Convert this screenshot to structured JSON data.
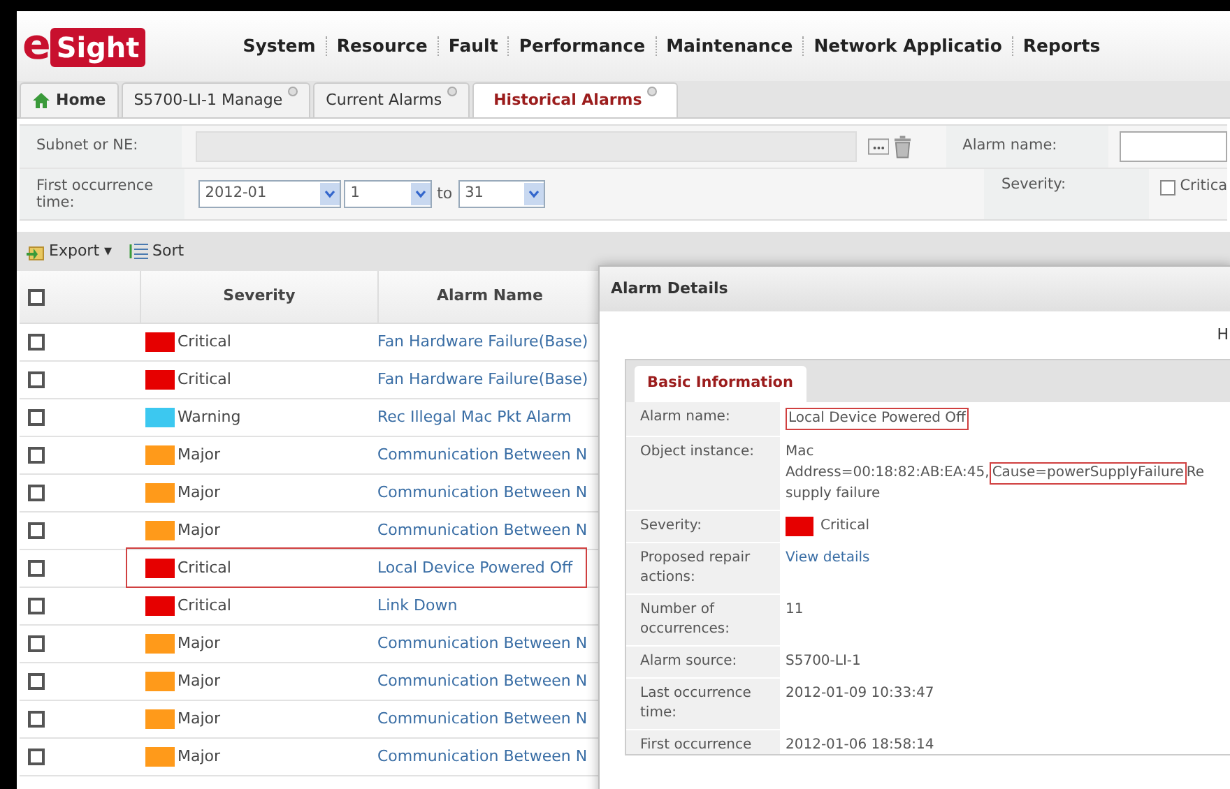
{
  "logo": {
    "text": "Sight",
    "prefix": "e"
  },
  "nav": [
    "System",
    "Resource",
    "Fault",
    "Performance",
    "Maintenance",
    "Network Applicatio",
    "Reports"
  ],
  "tabs": [
    {
      "label": "Home",
      "kind": "home",
      "selected": false
    },
    {
      "label": "S5700-LI-1 Manage",
      "kind": "page",
      "selected": false
    },
    {
      "label": "Current Alarms",
      "kind": "page",
      "selected": false
    },
    {
      "label": "Historical Alarms",
      "kind": "page",
      "selected": true
    }
  ],
  "filters": {
    "subnet_label": "Subnet or NE:",
    "time_label": "First occurrence time:",
    "month": "2012-01",
    "day_from": "1",
    "to_label": "to",
    "day_to": "31",
    "alarm_name_label": "Alarm name:",
    "severity_label": "Severity:",
    "severity_option": {
      "label": "Critica",
      "checked": false
    }
  },
  "toolbar": [
    "Export ▾",
    "Sort"
  ],
  "table": {
    "select_all": {
      "checked": false
    },
    "columns": [
      "Severity",
      "Alarm Name"
    ],
    "rows": [
      {
        "severity": "Critical",
        "color": "#e60000",
        "name": "Fan Hardware Failure(Base)",
        "checked": false,
        "highlighted": false
      },
      {
        "severity": "Critical",
        "color": "#e60000",
        "name": "Fan Hardware Failure(Base)",
        "checked": false,
        "highlighted": false
      },
      {
        "severity": "Warning",
        "color": "#3cc8f0",
        "name": "Rec Illegal Mac Pkt Alarm",
        "checked": false,
        "highlighted": false
      },
      {
        "severity": "Major",
        "color": "#ff9a1a",
        "name": "Communication Between N",
        "checked": false,
        "highlighted": false
      },
      {
        "severity": "Major",
        "color": "#ff9a1a",
        "name": "Communication Between N",
        "checked": false,
        "highlighted": false
      },
      {
        "severity": "Major",
        "color": "#ff9a1a",
        "name": "Communication Between N",
        "checked": false,
        "highlighted": false
      },
      {
        "severity": "Critical",
        "color": "#e60000",
        "name": "Local Device Powered Off",
        "checked": false,
        "highlighted": true
      },
      {
        "severity": "Critical",
        "color": "#e60000",
        "name": "Link Down",
        "checked": false,
        "highlighted": false
      },
      {
        "severity": "Major",
        "color": "#ff9a1a",
        "name": "Communication Between N",
        "checked": false,
        "highlighted": false
      },
      {
        "severity": "Major",
        "color": "#ff9a1a",
        "name": "Communication Between N",
        "checked": false,
        "highlighted": false
      },
      {
        "severity": "Major",
        "color": "#ff9a1a",
        "name": "Communication Between N",
        "checked": false,
        "highlighted": false
      },
      {
        "severity": "Major",
        "color": "#ff9a1a",
        "name": "Communication Between N",
        "checked": false,
        "highlighted": false
      }
    ]
  },
  "dialog": {
    "title": "Alarm Details",
    "corner_text": "H",
    "tab": "Basic Information",
    "fields": [
      {
        "label": "Alarm name:",
        "kind": "text",
        "lines": [
          [
            {
              "text": "Local Device Powered Off",
              "highlighted": true
            }
          ]
        ]
      },
      {
        "label": "Object instance:",
        "kind": "text",
        "lines": [
          [
            {
              "text": "Mac",
              "highlighted": false
            }
          ],
          [
            {
              "text": "Address=00:18:82:AB:EA:45,",
              "highlighted": false
            },
            {
              "text": "Cause=powerSupplyFailure",
              "highlighted": true
            },
            {
              "text": "Re",
              "highlighted": false
            }
          ],
          [
            {
              "text": "supply failure",
              "highlighted": false
            }
          ]
        ]
      },
      {
        "label": "Severity:",
        "kind": "severity",
        "color": "#e60000",
        "lines": [
          [
            {
              "text": "Critical",
              "highlighted": false
            }
          ]
        ]
      },
      {
        "label": "Proposed repair actions:",
        "kind": "link",
        "lines": [
          [
            {
              "text": "View details",
              "highlighted": false
            }
          ]
        ]
      },
      {
        "label": "Number of occurrences:",
        "kind": "text",
        "lines": [
          [
            {
              "text": "11",
              "highlighted": false
            }
          ]
        ]
      },
      {
        "label": "Alarm source:",
        "kind": "text",
        "lines": [
          [
            {
              "text": "S5700-LI-1",
              "highlighted": false
            }
          ]
        ]
      },
      {
        "label": "Last occurrence time:",
        "kind": "text",
        "lines": [
          [
            {
              "text": "2012-01-09 10:33:47",
              "highlighted": false
            }
          ]
        ]
      },
      {
        "label": "First occurrence",
        "kind": "text",
        "lines": [
          [
            {
              "text": "2012-01-06 18:58:14",
              "highlighted": false
            }
          ]
        ]
      }
    ]
  }
}
